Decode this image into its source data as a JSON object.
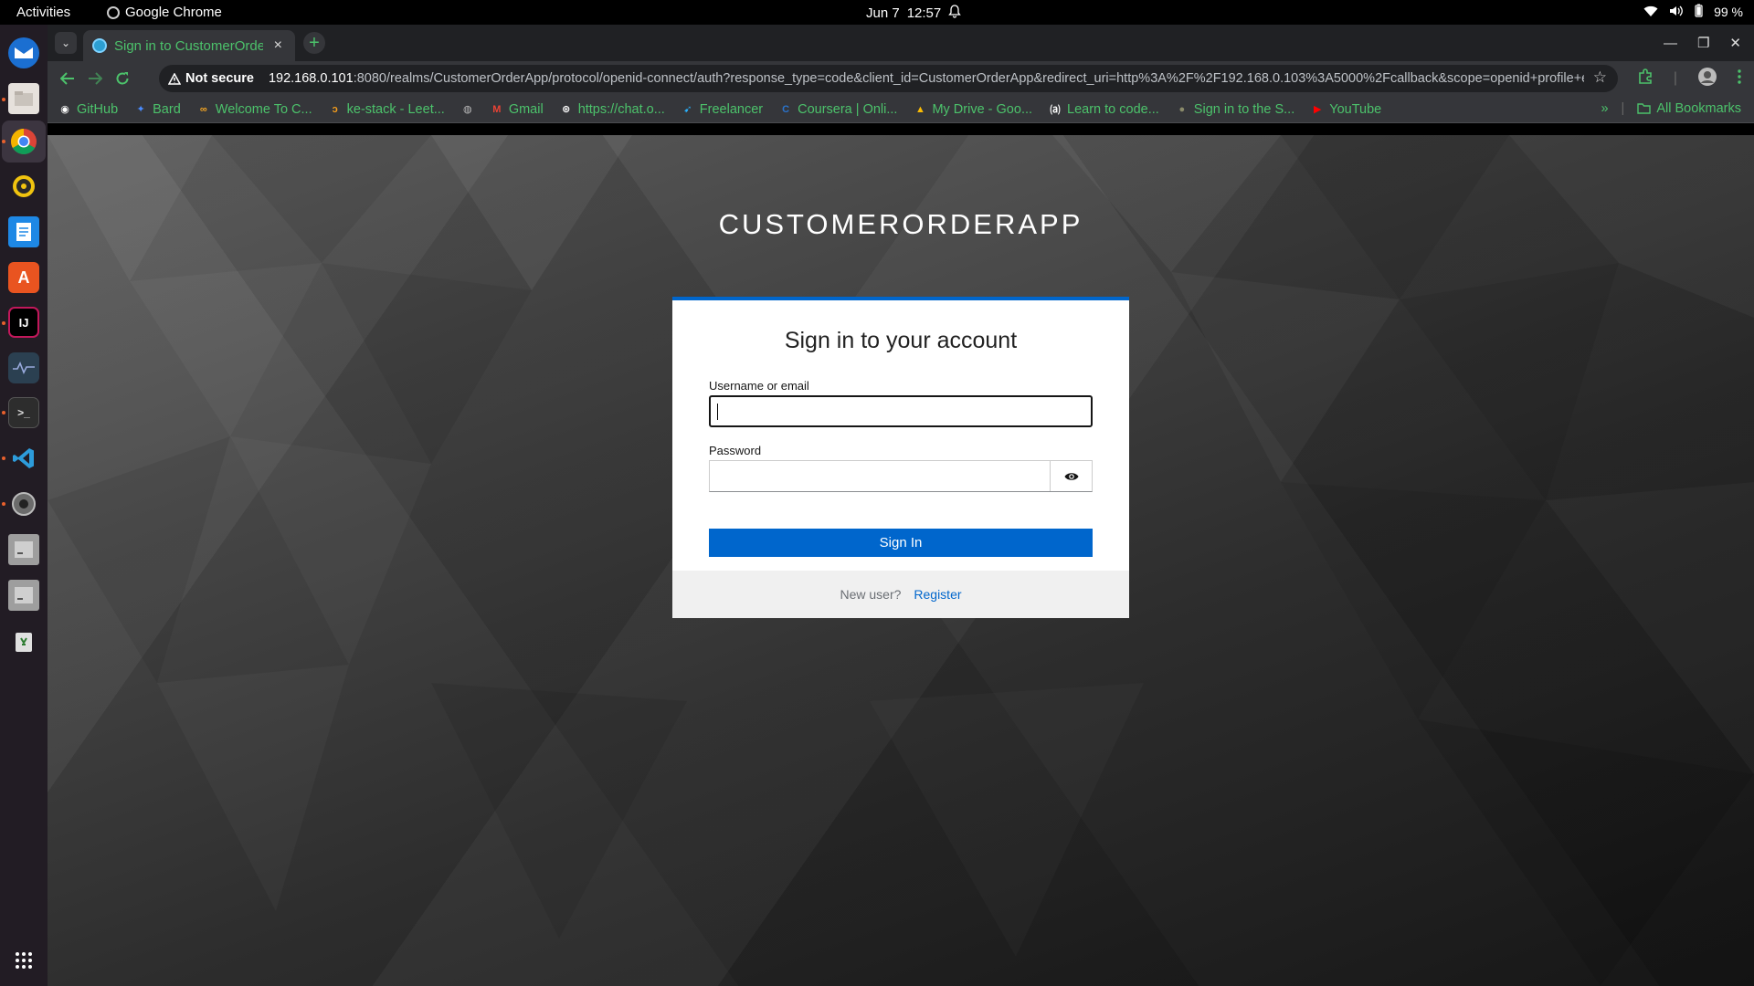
{
  "topbar": {
    "activities": "Activities",
    "app_name": "Google Chrome",
    "date": "Jun 7",
    "time": "12:57",
    "battery": "99 %"
  },
  "dock": {
    "items": [
      "thunderbird",
      "files",
      "chrome",
      "rhythmbox",
      "writer",
      "app-center",
      "intellij",
      "system-monitor",
      "terminal",
      "vscode",
      "settings",
      "drive-1",
      "drive-2",
      "trash"
    ],
    "show_apps": "show-apps"
  },
  "browser": {
    "tab_title": "Sign in to CustomerOrderApp",
    "tab_close": "×",
    "new_tab": "+",
    "security": "Not secure",
    "url_host": "192.168.0.101",
    "url_rest": ":8080/realms/CustomerOrderApp/protocol/openid-connect/auth?response_type=code&client_id=CustomerOrderApp&redirect_uri=http%3A%2F%2F192.168.0.103%3A5000%2Fcallback&scope=openid+profile+em...",
    "bookmarks": [
      {
        "label": "GitHub",
        "icon": "github-icon",
        "glyph": "◉",
        "color": "#ffffff"
      },
      {
        "label": "Bard",
        "icon": "bard-icon",
        "glyph": "✦",
        "color": "#4a8cff"
      },
      {
        "label": "Welcome To C...",
        "icon": "infinity-icon",
        "glyph": "∞",
        "color": "#f5a623"
      },
      {
        "label": "ke-stack - Leet...",
        "icon": "leetcode-icon",
        "glyph": "ↄ",
        "color": "#f89f1b"
      },
      {
        "label": "",
        "icon": "globe-icon",
        "glyph": "◍",
        "color": "#bbbbbb"
      },
      {
        "label": "Gmail",
        "icon": "gmail-icon",
        "glyph": "M",
        "color": "#ea4335"
      },
      {
        "label": "https://chat.o...",
        "icon": "chatgpt-icon",
        "glyph": "⊛",
        "color": "#ffffff"
      },
      {
        "label": "Freelancer",
        "icon": "freelancer-icon",
        "glyph": "➹",
        "color": "#29b2fe"
      },
      {
        "label": "Coursera | Onli...",
        "icon": "coursera-icon",
        "glyph": "C",
        "color": "#2a73cc"
      },
      {
        "label": "My Drive - Goo...",
        "icon": "drive-icon",
        "glyph": "▲",
        "color": "#fbbc04"
      },
      {
        "label": "Learn to code...",
        "icon": "freecodecamp-icon",
        "glyph": "⒜",
        "color": "#ffffff"
      },
      {
        "label": "Sign in to the S...",
        "icon": "avatar-icon",
        "glyph": "●",
        "color": "#8a8a6a"
      },
      {
        "label": "YouTube",
        "icon": "youtube-icon",
        "glyph": "▶",
        "color": "#ff0000"
      }
    ],
    "more_bookmarks": "»",
    "all_bookmarks": "All Bookmarks"
  },
  "login": {
    "realm": "CUSTOMERORDERAPP",
    "heading": "Sign in to your account",
    "username_label": "Username or email",
    "username_value": "",
    "password_label": "Password",
    "password_value": "",
    "submit": "Sign In",
    "new_user": "New user?",
    "register": "Register"
  },
  "colors": {
    "accent": "#0066cc",
    "chrome_green": "#4cc26b"
  }
}
